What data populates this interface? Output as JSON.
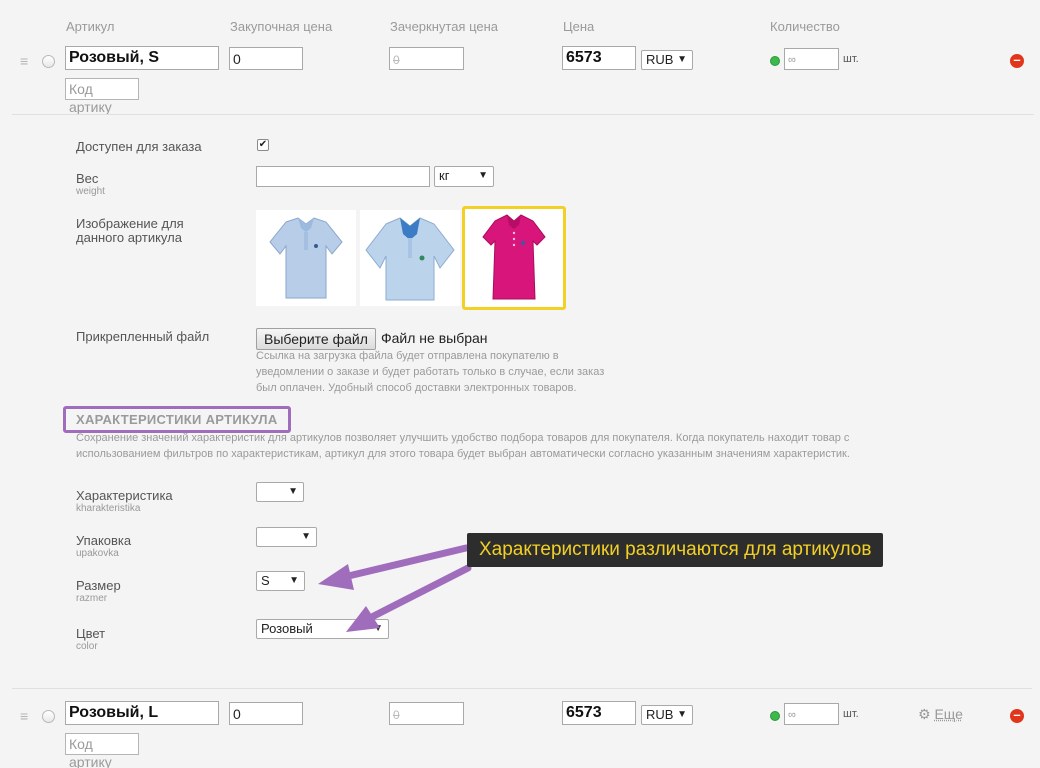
{
  "columns": {
    "sku": "Артикул",
    "purchase_price": "Закупочная цена",
    "compare_price": "Зачеркнутая цена",
    "price": "Цена",
    "quantity": "Количество"
  },
  "sku1": {
    "name": "Розовый, S",
    "purchase_price": "0",
    "compare_price": "0",
    "price": "6573",
    "currency": "RUB",
    "quantity": "∞",
    "unit": "шт.",
    "code_placeholder": "Код артику"
  },
  "details": {
    "available_label": "Доступен для заказа",
    "available_checked": "✔",
    "weight_label": "Вес",
    "weight_sub": "weight",
    "weight_unit": "кг",
    "image_label_line1": "Изображение для",
    "image_label_line2": "данного артикула",
    "file_label": "Прикрепленный файл",
    "file_button": "Выберите файл",
    "file_status": "Файл не выбран",
    "file_hint_1": "Ссылка на загрузка файла будет отправлена покупателю в",
    "file_hint_2": "уведомлении о заказе и будет работать только в случае, если заказ",
    "file_hint_3": "был оплачен. Удобный способ доставки электронных товаров."
  },
  "characteristics": {
    "title": "ХАРАКТЕРИСТИКИ АРТИКУЛА",
    "desc_1": "Сохранение значений характеристик для артикулов позволяет улучшить удобство подбора товаров для покупателя. Когда покупатель находит товар с",
    "desc_2": "использованием фильтров по характеристикам, артикул для этого товара будет выбран автоматически согласно указанным значениям характеристик.",
    "items": [
      {
        "label": "Характеристика",
        "sub": "kharakteristika",
        "value": ""
      },
      {
        "label": "Упаковка",
        "sub": "upakovka",
        "value": ""
      },
      {
        "label": "Размер",
        "sub": "razmer",
        "value": "S"
      },
      {
        "label": "Цвет",
        "sub": "color",
        "value": "Розовый"
      }
    ]
  },
  "callout": "Характеристики различаются для артикулов",
  "sku2": {
    "name": "Розовый, L",
    "purchase_price": "0",
    "compare_price": "0",
    "price": "6573",
    "currency": "RUB",
    "quantity": "∞",
    "unit": "шт.",
    "more": "Еще",
    "code_placeholder": "Код артику"
  },
  "colors": {
    "accent_purple": "#a06dbd",
    "highlight_yellow": "#f2d025",
    "remove_red": "#e2361c",
    "in_stock_green": "#3cb84c"
  }
}
